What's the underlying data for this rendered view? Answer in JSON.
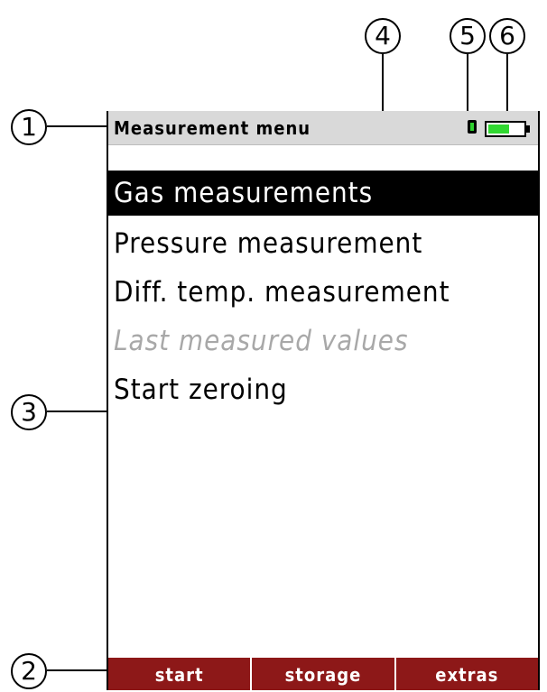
{
  "header": {
    "title": "Measurement menu"
  },
  "battery": {
    "level": 0.6
  },
  "menu": {
    "items": [
      {
        "label": "Gas measurements",
        "state": "selected"
      },
      {
        "label": "Pressure measurement",
        "state": "normal"
      },
      {
        "label": "Diff. temp. measurement",
        "state": "normal"
      },
      {
        "label": "Last measured values",
        "state": "disabled"
      },
      {
        "label": "Start zeroing",
        "state": "normal"
      }
    ]
  },
  "softkeys": {
    "left": "start",
    "middle": "storage",
    "right": "extras"
  },
  "callouts": {
    "c1": "1",
    "c2": "2",
    "c3": "3",
    "c4": "4",
    "c5": "5",
    "c6": "6"
  },
  "colors": {
    "softkey": "#8d1818",
    "battery": "#31d831",
    "header": "#d9d9d9"
  }
}
